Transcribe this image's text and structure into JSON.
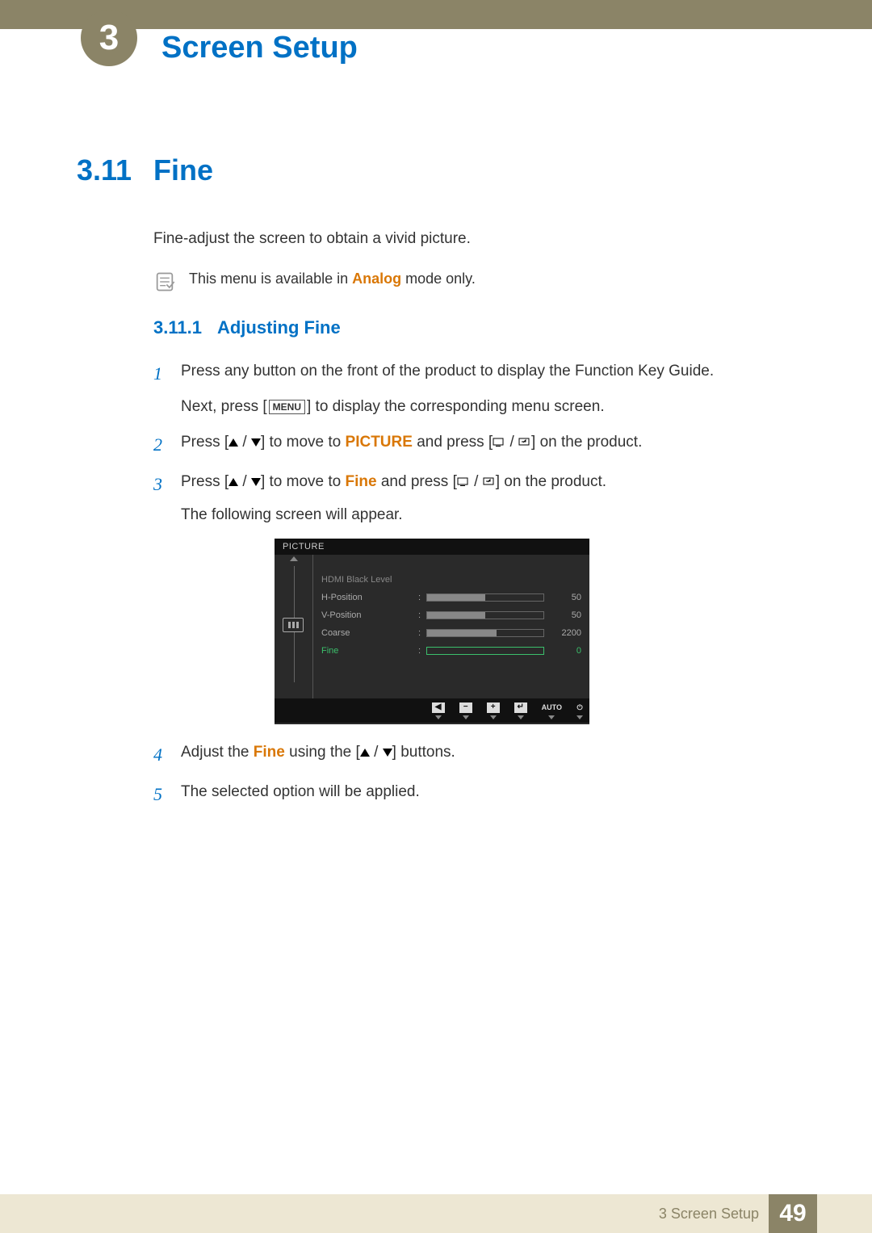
{
  "header": {
    "chapter_number": "3",
    "chapter_title": "Screen Setup"
  },
  "section": {
    "number": "3.11",
    "title": "Fine",
    "intro": "Fine-adjust the screen to obtain a vivid picture.",
    "note_prefix": "This menu is available in ",
    "note_highlight": "Analog",
    "note_suffix": " mode only."
  },
  "subsection": {
    "number": "3.11.1",
    "title": "Adjusting Fine"
  },
  "steps": {
    "s1_num": "1",
    "s1_line1": "Press any button on the front of the product to display the Function Key Guide.",
    "s1_line2a": "Next, press [",
    "s1_menu": "MENU",
    "s1_line2b": "] to display the corresponding menu screen.",
    "s2_num": "2",
    "s2_a": "Press [",
    "s2_b": "] to move to ",
    "s2_hl": "PICTURE",
    "s2_c": " and press [",
    "s2_d": "] on the product.",
    "s3_num": "3",
    "s3_a": "Press [",
    "s3_b": "] to move to ",
    "s3_hl": "Fine",
    "s3_c": " and press [",
    "s3_d": "] on the product.",
    "s3_line2": "The following screen will appear.",
    "s4_num": "4",
    "s4_a": "Adjust the ",
    "s4_hl": "Fine",
    "s4_b": " using the [",
    "s4_c": "] buttons.",
    "s5_num": "5",
    "s5": "The selected option will be applied."
  },
  "osd": {
    "title": "PICTURE",
    "rows": [
      {
        "label": "HDMI Black Level",
        "value": "",
        "fill": 0,
        "class": "hdmi",
        "has_slider": false
      },
      {
        "label": "H-Position",
        "value": "50",
        "fill": 50,
        "class": "",
        "has_slider": true
      },
      {
        "label": "V-Position",
        "value": "50",
        "fill": 50,
        "class": "",
        "has_slider": true
      },
      {
        "label": "Coarse",
        "value": "2200",
        "fill": 60,
        "class": "",
        "has_slider": true
      },
      {
        "label": "Fine",
        "value": "0",
        "fill": 0,
        "class": "selected",
        "has_slider": true
      }
    ],
    "footer": {
      "back": "◀",
      "minus": "−",
      "plus": "+",
      "enter": "↵",
      "auto": "AUTO",
      "power": "⏻"
    }
  },
  "footer": {
    "text": "3 Screen Setup",
    "page": "49"
  }
}
